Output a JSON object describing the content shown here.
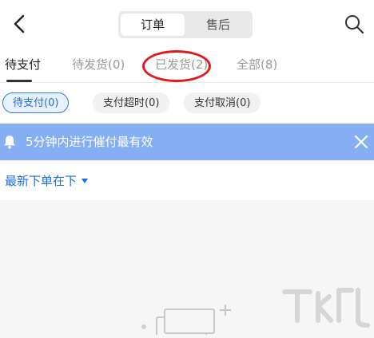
{
  "header": {
    "segments": [
      {
        "label": "订单",
        "active": true
      },
      {
        "label": "售后",
        "active": false
      }
    ]
  },
  "tabs": [
    {
      "label": "待支付",
      "active": true
    },
    {
      "label": "待发货(0)",
      "active": false
    },
    {
      "label": "已发货(2)",
      "active": false
    },
    {
      "label": "全部(8)",
      "active": false
    }
  ],
  "filters": [
    {
      "label": "待支付(0)",
      "active": true
    },
    {
      "label": "支付超时(0)",
      "active": false
    },
    {
      "label": "支付取消(0)",
      "active": false
    }
  ],
  "banner": {
    "text": "5分钟内进行催付最有效",
    "color": "#86aef2"
  },
  "sort": {
    "label": "最新下单在下"
  },
  "accent_color": "#1d6fd9",
  "highlight_color": "#e01b1b",
  "icons": [
    "back-arrow-icon",
    "search-icon",
    "grid-icon",
    "bell-icon",
    "close-icon",
    "dropdown-arrow-icon"
  ]
}
